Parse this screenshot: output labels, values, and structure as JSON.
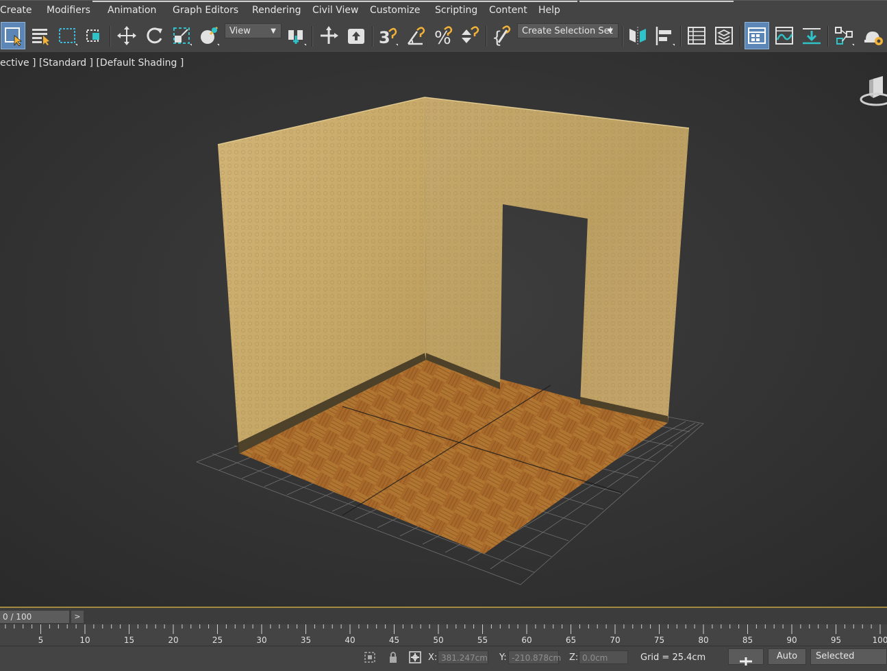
{
  "menu": {
    "items": [
      "Create",
      "Modifiers",
      "Animation",
      "Graph Editors",
      "Rendering",
      "Civil View",
      "Customize",
      "Scripting",
      "Content",
      "Help"
    ]
  },
  "toolbar": {
    "view_dropdown": "View",
    "selection_set_dropdown": "Create Selection Set",
    "accent_color": "#5b86b5",
    "icons": [
      "select-object-icon",
      "select-by-name-icon",
      "rectangular-selection-icon",
      "window-crossing-icon",
      "move-icon",
      "rotate-icon",
      "scale-icon",
      "placement-icon",
      "select-manipulate-icon",
      "pivot-icon",
      "keyboard-override-icon",
      "snaps-toggle-icon",
      "angle-snap-icon",
      "percent-snap-icon",
      "spinner-snap-icon",
      "edit-named-sets-icon",
      "mirror-icon",
      "align-icon",
      "scene-explorer-icon",
      "layer-explorer-icon",
      "ribbon-icon",
      "curve-editor-icon",
      "schematic-view-icon",
      "material-editor-icon",
      "render-setup-icon"
    ]
  },
  "viewport": {
    "label": "ective ] [Standard ] [Default Shading ]",
    "wall_color": "#c7a96a",
    "floor_color": "#a5692a",
    "background_color": "#333333"
  },
  "timeslider": {
    "frame_display": "0 / 100",
    "next_label": ">",
    "accent_color": "#a38a3f"
  },
  "trackbar": {
    "ticks": [
      "5",
      "10",
      "15",
      "20",
      "25",
      "30",
      "35",
      "40",
      "45",
      "50",
      "55",
      "60",
      "65",
      "70",
      "75",
      "80",
      "85",
      "90",
      "95",
      "100"
    ]
  },
  "status": {
    "x_label": "X:",
    "x_value": "381.247cm",
    "y_label": "Y:",
    "y_value": "-210.878cm",
    "z_label": "Z:",
    "z_value": "0.0cm",
    "grid": "Grid = 25.4cm",
    "auto_key": "Auto",
    "key_mode": "Selected"
  }
}
